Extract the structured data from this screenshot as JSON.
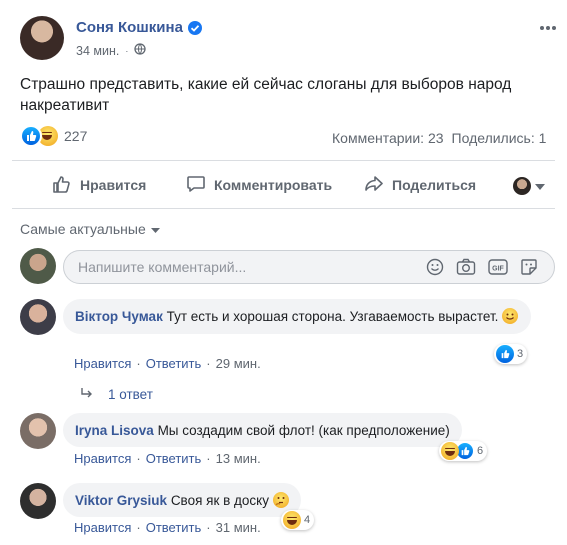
{
  "post": {
    "author": "Соня Кошкина",
    "time": "34 мин.",
    "text": "Страшно представить, какие ей сейчас слоганы для выборов народ накреативит",
    "reactions_count": "227",
    "comments_count": "Комментарии: 23",
    "shares_count": "Поделились: 1",
    "more_icon": "more-dots-icon",
    "privacy_icon": "globe-icon"
  },
  "actions": {
    "like": "Нравится",
    "comment": "Комментировать",
    "share": "Поделиться"
  },
  "sort": {
    "label": "Самые актуальные"
  },
  "composer": {
    "placeholder": "Напишите комментарий..."
  },
  "comments": [
    {
      "author": "Віктор Чумак",
      "text": "Тут есть и хорошая сторона. Узгаваемость вырастет.",
      "like": "Нравится",
      "reply": "Ответить",
      "time": "29 мин.",
      "reactions": "3",
      "replies": "1 ответ"
    },
    {
      "author": "Iryna Lisova",
      "text": "Мы создадим свой флот! (как предположение)",
      "like": "Нравится",
      "reply": "Ответить",
      "time": "13 мин.",
      "reactions": "6"
    },
    {
      "author": "Viktor Grysiuk",
      "text": "Своя як в доску",
      "like": "Нравится",
      "reply": "Ответить",
      "time": "31 мин.",
      "reactions": "4"
    }
  ],
  "colors": {
    "link": "#385898",
    "muted": "#606770",
    "bubble": "#f2f3f5",
    "verified": "#1877f2"
  }
}
